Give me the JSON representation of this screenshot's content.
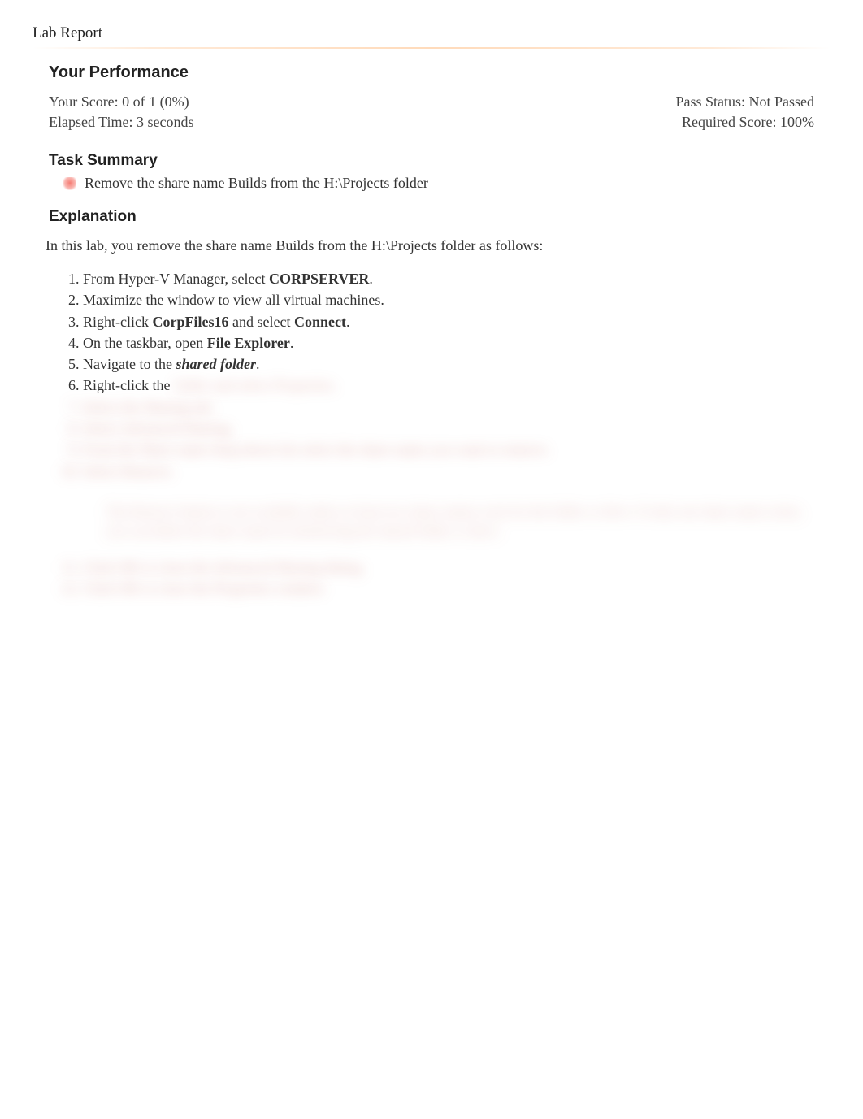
{
  "header": {
    "title": "Lab Report"
  },
  "performance": {
    "heading": "Your Performance",
    "score_label": "Your Score: 0 of 1 (0%)",
    "pass_label": "Pass Status: Not Passed",
    "time_label": "Elapsed Time: 3 seconds",
    "required_label": "Required Score: 100%"
  },
  "task_summary": {
    "heading": "Task Summary",
    "items": [
      {
        "status": "fail",
        "text": "Remove the share name Builds from the H:\\Projects folder"
      }
    ]
  },
  "explanation": {
    "heading": "Explanation",
    "intro": "In this lab, you remove the share name Builds from the H:\\Projects folder as follows:",
    "steps": [
      {
        "prefix": "From Hyper-V Manager, select ",
        "bold": "CORPSERVER",
        "suffix": "."
      },
      {
        "prefix": "Maximize the window to view all virtual machines.",
        "bold": "",
        "suffix": ""
      },
      {
        "prefix": " Right-click ",
        "bold": "CorpFiles16",
        "mid": " and select ",
        "bold2": "Connect",
        "suffix": "."
      },
      {
        "prefix": "On the taskbar, open ",
        "bold": "File Explorer",
        "suffix": "."
      },
      {
        "prefix": "Navigate to the ",
        "bolditalic": "shared folder",
        "suffix": "."
      },
      {
        "prefix": "Right-click the ",
        "blurred": "folder and select Properties."
      }
    ],
    "blurred_steps": [
      "Select the Sharing tab.",
      "Select Advanced Sharing.",
      "From the Share name drop-down list select the share name you want to remove.",
      "Select Remove."
    ],
    "note": "The Remove button is not available unless at least two share names exist for the folder or drive. If only one share name exists, you can delete the share name by deselecting the shared folder or drive.",
    "blurred_steps_2": [
      "Click OK to close the Advanced Sharing dialog.",
      "Click OK to close the Properties window."
    ]
  }
}
